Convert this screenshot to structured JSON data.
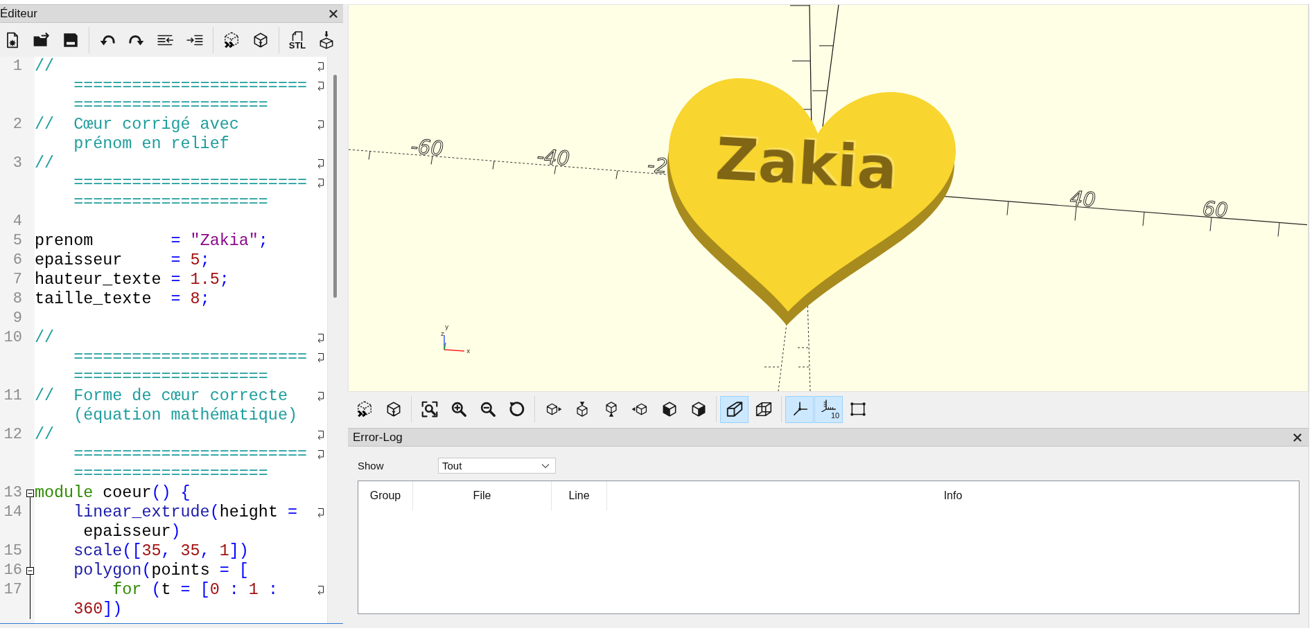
{
  "editor": {
    "title": "Éditeur",
    "toolbar": [
      [
        {
          "kind": "new"
        },
        {
          "kind": "open"
        },
        {
          "kind": "save"
        }
      ],
      [
        {
          "kind": "undo"
        },
        {
          "kind": "redo"
        },
        {
          "kind": "unindent"
        },
        {
          "kind": "indent"
        }
      ],
      [
        {
          "kind": "preview"
        },
        {
          "kind": "render"
        }
      ],
      [
        {
          "kind": "export_stl",
          "label": "STL"
        },
        {
          "kind": "print_3d"
        }
      ]
    ],
    "lines": [
      {
        "number": "1",
        "foldable": false,
        "wraps": [
          {
            "tokens": [
              {
                "kind": "comment",
                "text": "//"
              }
            ]
          },
          {
            "tokens": [
              {
                "kind": "comment",
                "text": "========================"
              }
            ]
          },
          {
            "tokens": [
              {
                "kind": "comment",
                "text": "===================="
              }
            ]
          }
        ]
      },
      {
        "number": "2",
        "foldable": false,
        "wraps": [
          {
            "tokens": [
              {
                "kind": "comment",
                "text": "//  Cœur corrigé avec"
              }
            ]
          },
          {
            "tokens": [
              {
                "kind": "comment",
                "text": "prénom en relief"
              }
            ]
          }
        ]
      },
      {
        "number": "3",
        "foldable": false,
        "wraps": [
          {
            "tokens": [
              {
                "kind": "comment",
                "text": "//"
              }
            ]
          },
          {
            "tokens": [
              {
                "kind": "comment",
                "text": "========================"
              }
            ]
          },
          {
            "tokens": [
              {
                "kind": "comment",
                "text": "===================="
              }
            ]
          }
        ]
      },
      {
        "number": "4",
        "foldable": false
      },
      {
        "number": "5",
        "foldable": false,
        "wraps": [
          {
            "tokens": [
              {
                "kind": "plain",
                "text": "prenom        "
              },
              {
                "kind": "punct",
                "text": "= "
              },
              {
                "kind": "string",
                "text": "\"Zakia\""
              },
              {
                "kind": "punct",
                "text": ";"
              }
            ]
          }
        ]
      },
      {
        "number": "6",
        "foldable": false,
        "wraps": [
          {
            "tokens": [
              {
                "kind": "plain",
                "text": "epaisseur     "
              },
              {
                "kind": "punct",
                "text": "= "
              },
              {
                "kind": "number",
                "text": "5"
              },
              {
                "kind": "punct",
                "text": ";"
              }
            ]
          }
        ]
      },
      {
        "number": "7",
        "foldable": false,
        "wraps": [
          {
            "tokens": [
              {
                "kind": "plain",
                "text": "hauteur_texte "
              },
              {
                "kind": "punct",
                "text": "= "
              },
              {
                "kind": "number",
                "text": "1.5"
              },
              {
                "kind": "punct",
                "text": ";"
              }
            ]
          }
        ]
      },
      {
        "number": "8",
        "foldable": false,
        "wraps": [
          {
            "tokens": [
              {
                "kind": "plain",
                "text": "taille_texte  "
              },
              {
                "kind": "punct",
                "text": "= "
              },
              {
                "kind": "number",
                "text": "8"
              },
              {
                "kind": "punct",
                "text": ";"
              }
            ]
          }
        ]
      },
      {
        "number": "9",
        "foldable": false
      },
      {
        "number": "10",
        "foldable": false,
        "wraps": [
          {
            "tokens": [
              {
                "kind": "comment",
                "text": "//"
              }
            ]
          },
          {
            "tokens": [
              {
                "kind": "comment",
                "text": "========================"
              }
            ]
          },
          {
            "tokens": [
              {
                "kind": "comment",
                "text": "===================="
              }
            ]
          }
        ]
      },
      {
        "number": "11",
        "foldable": false,
        "wraps": [
          {
            "tokens": [
              {
                "kind": "comment",
                "text": "//  Forme de cœur correcte"
              }
            ]
          },
          {
            "tokens": [
              {
                "kind": "comment",
                "text": "(équation mathématique)"
              }
            ]
          }
        ]
      },
      {
        "number": "12",
        "foldable": false,
        "wraps": [
          {
            "tokens": [
              {
                "kind": "comment",
                "text": "//"
              }
            ]
          },
          {
            "tokens": [
              {
                "kind": "comment",
                "text": "========================"
              }
            ]
          },
          {
            "tokens": [
              {
                "kind": "comment",
                "text": "===================="
              }
            ]
          }
        ]
      },
      {
        "number": "13",
        "foldable": true,
        "wraps": [
          {
            "tokens": [
              {
                "kind": "keyword",
                "text": "module"
              },
              {
                "kind": "plain",
                "text": " coeur"
              },
              {
                "kind": "punct",
                "text": "() {"
              }
            ]
          }
        ]
      },
      {
        "number": "14",
        "foldable": false,
        "wraps": [
          {
            "tokens": [
              {
                "kind": "builtin",
                "text": "    linear_extrude"
              },
              {
                "kind": "punct",
                "text": "("
              },
              {
                "kind": "plain",
                "text": "height "
              },
              {
                "kind": "punct",
                "text": "="
              }
            ]
          },
          {
            "tokens": [
              {
                "kind": "plain",
                "text": " epaisseur"
              },
              {
                "kind": "punct",
                "text": ")"
              }
            ]
          }
        ]
      },
      {
        "number": "15",
        "foldable": false,
        "wraps": [
          {
            "tokens": [
              {
                "kind": "builtin",
                "text": "    scale"
              },
              {
                "kind": "punct",
                "text": "(["
              },
              {
                "kind": "number",
                "text": "35"
              },
              {
                "kind": "punct",
                "text": ", "
              },
              {
                "kind": "number",
                "text": "35"
              },
              {
                "kind": "punct",
                "text": ", "
              },
              {
                "kind": "number",
                "text": "1"
              },
              {
                "kind": "punct",
                "text": "])"
              }
            ]
          }
        ]
      },
      {
        "number": "16",
        "foldable": true,
        "wraps": [
          {
            "tokens": [
              {
                "kind": "builtin",
                "text": "    polygon"
              },
              {
                "kind": "punct",
                "text": "("
              },
              {
                "kind": "plain",
                "text": "points "
              },
              {
                "kind": "punct",
                "text": "= ["
              }
            ]
          }
        ]
      },
      {
        "number": "17",
        "foldable": false,
        "wraps": [
          {
            "tokens": [
              {
                "kind": "keyword",
                "text": "        for"
              },
              {
                "kind": "punct",
                "text": " ("
              },
              {
                "kind": "plain",
                "text": "t "
              },
              {
                "kind": "punct",
                "text": "= ["
              },
              {
                "kind": "number",
                "text": "0"
              },
              {
                "kind": "punct",
                "text": " : "
              },
              {
                "kind": "number",
                "text": "1"
              },
              {
                "kind": "punct",
                "text": " :"
              }
            ]
          },
          {
            "tokens": [
              {
                "kind": "number",
                "text": "360"
              },
              {
                "kind": "punct",
                "text": "])"
              }
            ]
          }
        ]
      }
    ]
  },
  "viewer": {
    "axis_labels": [
      "-60",
      "-40",
      "-2",
      "40",
      "60"
    ],
    "model_text": "Zakia",
    "gizmo_labels": [
      "y",
      "z",
      "x"
    ],
    "toolbar": [
      [
        {
          "kind": "preview",
          "on": false
        },
        {
          "kind": "render",
          "on": false
        }
      ],
      [
        {
          "kind": "view_all",
          "on": false
        },
        {
          "kind": "zoom_in",
          "on": false
        },
        {
          "kind": "zoom_out",
          "on": false
        },
        {
          "kind": "reset_view",
          "on": false
        }
      ],
      [
        {
          "kind": "view_right",
          "on": false
        },
        {
          "kind": "view_top",
          "on": false
        },
        {
          "kind": "view_bottom",
          "on": false
        },
        {
          "kind": "view_left",
          "on": false
        },
        {
          "kind": "view_front",
          "on": false
        },
        {
          "kind": "view_back",
          "on": false
        }
      ],
      [
        {
          "kind": "perspective",
          "on": true
        },
        {
          "kind": "orthogonal",
          "on": false
        }
      ],
      [
        {
          "kind": "axes",
          "on": true
        },
        {
          "kind": "scale_markers",
          "on": true,
          "label": "10"
        },
        {
          "kind": "edges",
          "on": false
        }
      ]
    ]
  },
  "error_log": {
    "title": "Error-Log",
    "show_label": "Show",
    "filter": "Tout",
    "columns": [
      "Group",
      "File",
      "Line",
      "Info"
    ]
  }
}
